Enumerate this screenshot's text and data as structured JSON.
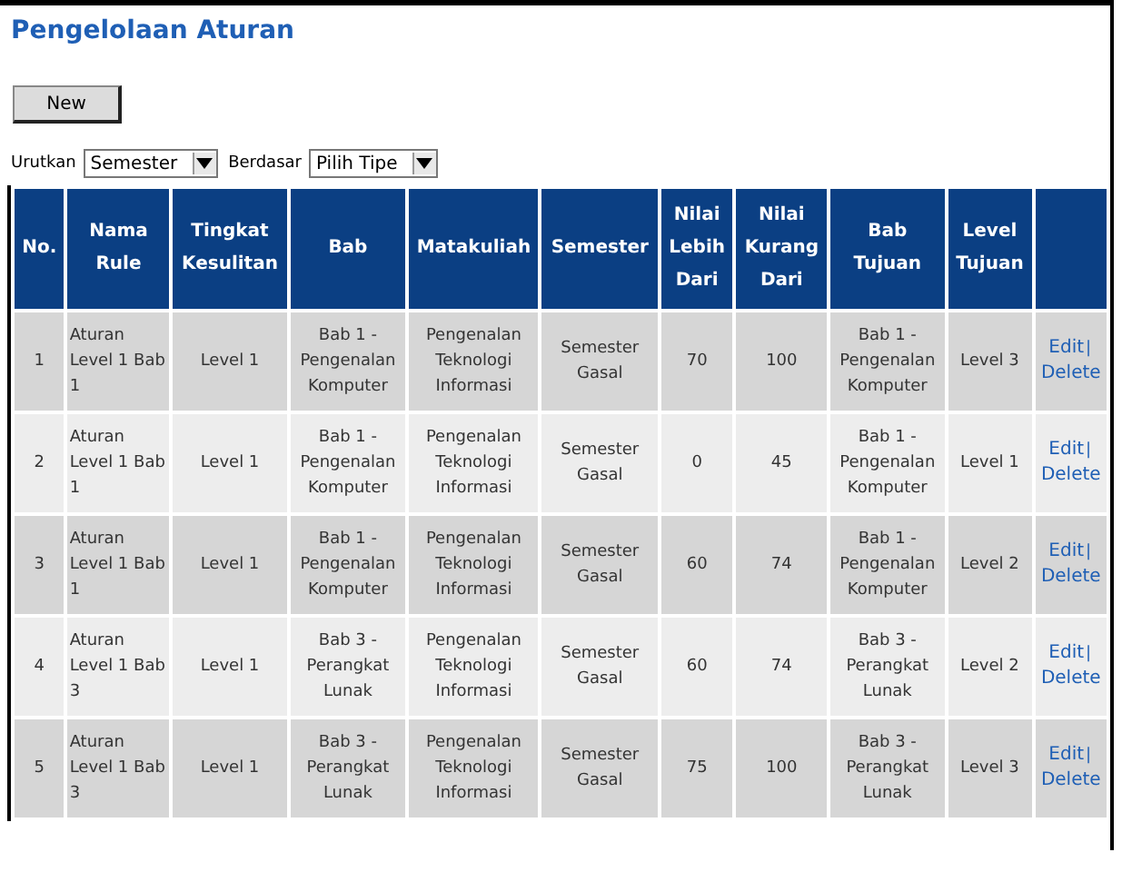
{
  "title": "Pengelolaan Aturan",
  "new_button": "New",
  "filters": [
    {
      "label": "Urutkan",
      "value": "Semester"
    },
    {
      "label": "Berdasar",
      "value": "Pilih Tipe"
    }
  ],
  "table": {
    "columns": [
      "No.",
      "Nama Rule",
      "Tingkat Kesulitan",
      "Bab",
      "Matakuliah",
      "Semester",
      "Nilai Lebih Dari",
      "Nilai Kurang Dari",
      "Bab Tujuan",
      "Level Tujuan",
      ""
    ],
    "rows": [
      {
        "cells": [
          "1",
          "Aturan Level 1 Bab 1",
          "Level 1",
          "Bab 1 - Pengenalan Komputer",
          "Pengenalan Teknologi Informasi",
          "Semester Gasal",
          "70",
          "100",
          "Bab 1 - Pengenalan Komputer",
          "Level 3"
        ],
        "actions": [
          "Edit",
          "Delete"
        ],
        "separator": "|"
      },
      {
        "cells": [
          "2",
          "Aturan Level 1 Bab 1",
          "Level 1",
          "Bab 1 - Pengenalan Komputer",
          "Pengenalan Teknologi Informasi",
          "Semester Gasal",
          "0",
          "45",
          "Bab 1 - Pengenalan Komputer",
          "Level 1"
        ],
        "actions": [
          "Edit",
          "Delete"
        ],
        "separator": "|"
      },
      {
        "cells": [
          "3",
          "Aturan Level 1 Bab 1",
          "Level 1",
          "Bab 1 - Pengenalan Komputer",
          "Pengenalan Teknologi Informasi",
          "Semester Gasal",
          "60",
          "74",
          "Bab 1 - Pengenalan Komputer",
          "Level 2"
        ],
        "actions": [
          "Edit",
          "Delete"
        ],
        "separator": "|"
      },
      {
        "cells": [
          "4",
          "Aturan Level 1 Bab 3",
          "Level 1",
          "Bab 3 - Perangkat Lunak",
          "Pengenalan Teknologi Informasi",
          "Semester Gasal",
          "60",
          "74",
          "Bab 3 - Perangkat Lunak",
          "Level 2"
        ],
        "actions": [
          "Edit",
          "Delete"
        ],
        "separator": "|"
      },
      {
        "cells": [
          "5",
          "Aturan Level 1 Bab 3",
          "Level 1",
          "Bab 3 - Perangkat Lunak",
          "Pengenalan Teknologi Informasi",
          "Semester Gasal",
          "75",
          "100",
          "Bab 3 - Perangkat Lunak",
          "Level 3"
        ],
        "actions": [
          "Edit",
          "Delete"
        ],
        "separator": "|"
      }
    ]
  }
}
